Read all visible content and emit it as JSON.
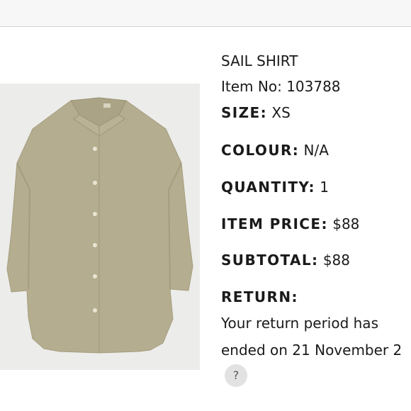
{
  "product": {
    "name": "SAIL SHIRT",
    "item_no_label": "Item No:",
    "item_no": "103788",
    "size_label": "SIZE:",
    "size": "XS",
    "colour_label": "COLOUR:",
    "colour": "N/A",
    "quantity_label": "QUANTITY:",
    "quantity": "1",
    "price_label": "ITEM PRICE:",
    "price": "$88",
    "subtotal_label": "SUBTOTAL:",
    "subtotal": "$88",
    "return_label": "RETURN:",
    "return_line1": "Your return period has",
    "return_line2": "ended on 21 November 2",
    "image_color": "#b5ad8f"
  },
  "help": {
    "icon": "question-icon",
    "glyph": "?"
  }
}
